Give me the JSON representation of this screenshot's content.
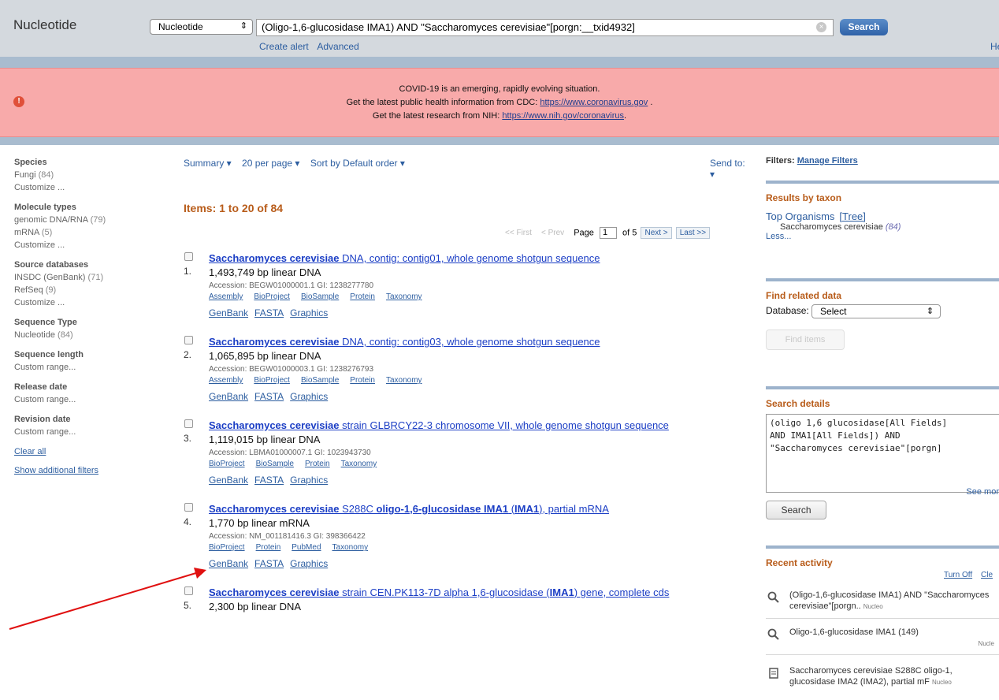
{
  "header": {
    "app_title": "Nucleotide",
    "db_select": "Nucleotide",
    "search_query": "(Oligo-1,6-glucosidase IMA1) AND \"Saccharomyces cerevisiae\"[porgn:__txid4932]",
    "search_button": "Search",
    "create_alert": "Create alert",
    "advanced": "Advanced",
    "help": "He"
  },
  "alert": {
    "line1": "COVID-19 is an emerging, rapidly evolving situation.",
    "line2_text": "Get the latest public health information from CDC: ",
    "line2_link": "https://www.coronavirus.gov",
    "line2_end": " .",
    "line3_text": "Get the latest research from NIH: ",
    "line3_link": "https://www.nih.gov/coronavirus",
    "line3_end": "."
  },
  "sidebar": {
    "species_title": "Species",
    "species_item": "Fungi",
    "species_count": "(84)",
    "species_customize": "Customize ...",
    "molecule_title": "Molecule types",
    "molecule_item1": "genomic DNA/RNA",
    "molecule_count1": "(79)",
    "molecule_item2": "mRNA",
    "molecule_count2": "(5)",
    "molecule_customize": "Customize ...",
    "source_title": "Source databases",
    "source_item1": "INSDC (GenBank)",
    "source_count1": "(71)",
    "source_item2": "RefSeq",
    "source_count2": "(9)",
    "source_customize": "Customize ...",
    "seqtype_title": "Sequence Type",
    "seqtype_item": "Nucleotide",
    "seqtype_count": "(84)",
    "seqlen_title": "Sequence length",
    "seqlen_item": "Custom range...",
    "release_title": "Release date",
    "release_item": "Custom range...",
    "revision_title": "Revision date",
    "revision_item": "Custom range...",
    "clear_all": "Clear all",
    "show_filters": "Show additional filters"
  },
  "toolbar": {
    "summary": "Summary ▾",
    "per_page": "20 per page ▾",
    "sort": "Sort by Default order ▾",
    "send_to": "Send to: ▾"
  },
  "items_count": "Items: 1 to 20 of 84",
  "pager": {
    "first": "<< First",
    "prev": "< Prev",
    "page_label": "Page",
    "page_value": "1",
    "of": "of 5",
    "next": "Next >",
    "last": "Last >>"
  },
  "results": [
    {
      "num": "1.",
      "title_bold": "Saccharomyces cerevisiae",
      "title_rest": " DNA, contig: contig01, whole genome shotgun sequence",
      "desc": "1,493,749 bp linear DNA",
      "accession": "Accession: BEGW01000001.1   GI: 1238277780",
      "links1": [
        "Assembly",
        "BioProject",
        "BioSample",
        "Protein",
        "Taxonomy"
      ],
      "links2": [
        "GenBank",
        "FASTA",
        "Graphics"
      ]
    },
    {
      "num": "2.",
      "title_bold": "Saccharomyces cerevisiae",
      "title_rest": " DNA, contig: contig03, whole genome shotgun sequence",
      "desc": "1,065,895 bp linear DNA",
      "accession": "Accession: BEGW01000003.1   GI: 1238276793",
      "links1": [
        "Assembly",
        "BioProject",
        "BioSample",
        "Protein",
        "Taxonomy"
      ],
      "links2": [
        "GenBank",
        "FASTA",
        "Graphics"
      ]
    },
    {
      "num": "3.",
      "title_bold": "Saccharomyces cerevisiae",
      "title_rest": " strain GLBRCY22-3 chromosome VII, whole genome shotgun sequence",
      "desc": "1,119,015 bp linear DNA",
      "accession": "Accession: LBMA01000007.1   GI: 1023943730",
      "links1": [
        "BioProject",
        "BioSample",
        "Protein",
        "Taxonomy"
      ],
      "links2": [
        "GenBank",
        "FASTA",
        "Graphics"
      ]
    },
    {
      "num": "4.",
      "title_html_parts": [
        "Saccharomyces cerevisiae",
        " S288C ",
        "oligo-1,6-glucosidase IMA1",
        " (",
        "IMA1",
        "), partial mRNA"
      ],
      "desc": "1,770 bp linear mRNA",
      "accession": "Accession: NM_001181416.3   GI: 398366422",
      "links1": [
        "BioProject",
        "Protein",
        "PubMed",
        "Taxonomy"
      ],
      "links2": [
        "GenBank",
        "FASTA",
        "Graphics"
      ]
    },
    {
      "num": "5.",
      "title_html_parts": [
        "Saccharomyces cerevisiae",
        " strain CEN.PK113-7D alpha 1,6-glucosidase (",
        "IMA1",
        ") gene, complete cds"
      ],
      "desc": "2,300 bp linear DNA"
    }
  ],
  "right": {
    "filters_label": "Filters:",
    "manage_filters": "Manage Filters",
    "taxon_title": "Results by taxon",
    "top_organisms": "Top Organisms",
    "tree": "[Tree]",
    "organism": "Saccharomyces cerevisiae",
    "organism_count": "(84)",
    "less": "Less...",
    "related_title": "Find related data",
    "database_label": "Database:",
    "database_value": "Select",
    "find_items": "Find items",
    "details_title": "Search details",
    "details_text": "(oligo 1,6 glucosidase[All Fields]\nAND IMA1[All Fields]) AND\n\"Saccharomyces cerevisiae\"[porgn]",
    "details_search": "Search",
    "see_more": "See mor",
    "recent_title": "Recent activity",
    "turn_off": "Turn Off",
    "clear": "Cle",
    "recent1": "(Oligo-1,6-glucosidase IMA1) AND \"Saccharomyces cerevisiae\"[porgn..",
    "recent1_src": "Nucleo",
    "recent2": "Oligo-1,6-glucosidase IMA1 (149)",
    "recent2_src": "Nucle",
    "recent3": "Saccharomyces cerevisiae S288C oligo-1, glucosidase IMA2 (IMA2), partial mF",
    "recent3_src": "Nucleo"
  },
  "colors": {
    "link": "#1b3ec5",
    "accent": "#b85c1a",
    "alert_bg": "#f8aaaa",
    "annotation_arrow": "#e01010"
  }
}
